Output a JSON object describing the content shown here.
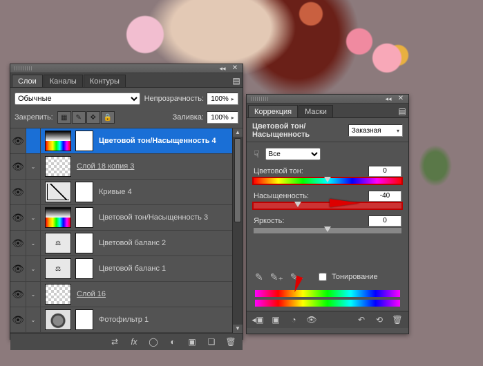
{
  "layers_panel": {
    "tabs": [
      "Слои",
      "Каналы",
      "Контуры"
    ],
    "active_tab": 0,
    "blend_mode": "Обычные",
    "opacity_label": "Непрозрачность:",
    "opacity_value": "100%",
    "lock_label": "Закрепить:",
    "fill_label": "Заливка:",
    "fill_value": "100%",
    "layers": [
      {
        "name": "Цветовой тон/Насыщенность 4",
        "selected": true,
        "kind": "adj-hue",
        "mask": true,
        "sub": false,
        "underline": false
      },
      {
        "name": "Слой 18 копия 3",
        "selected": false,
        "kind": "transparent",
        "mask": false,
        "sub": true,
        "underline": true
      },
      {
        "name": "Кривые 4",
        "selected": false,
        "kind": "adj-curves",
        "mask": true,
        "sub": false,
        "underline": false
      },
      {
        "name": "Цветовой тон/Насыщенность 3",
        "selected": false,
        "kind": "adj-hue",
        "mask": true,
        "sub": true,
        "underline": false
      },
      {
        "name": "Цветовой баланс 2",
        "selected": false,
        "kind": "adj-balance",
        "mask": true,
        "sub": true,
        "underline": false
      },
      {
        "name": "Цветовой баланс 1",
        "selected": false,
        "kind": "adj-balance",
        "mask": true,
        "sub": true,
        "underline": false
      },
      {
        "name": "Слой 16",
        "selected": false,
        "kind": "transparent",
        "mask": false,
        "sub": true,
        "underline": true
      },
      {
        "name": "Фотофильтр 1",
        "selected": false,
        "kind": "adj-photofilter",
        "mask": true,
        "sub": true,
        "underline": false
      }
    ],
    "footer_icons": [
      "link",
      "fx",
      "mask",
      "adj",
      "group",
      "new",
      "trash"
    ]
  },
  "adjust_panel": {
    "tabs": [
      "Коррекция",
      "Маски"
    ],
    "active_tab": 0,
    "title": "Цветовой тон/Насыщенность",
    "preset": "Заказная",
    "edit_label": "Все",
    "sliders": {
      "hue": {
        "label": "Цветовой тон:",
        "value": "0",
        "knob_pct": 50
      },
      "saturation": {
        "label": "Насыщенность:",
        "value": "-40",
        "knob_pct": 30
      },
      "lightness": {
        "label": "Яркость:",
        "value": "0",
        "knob_pct": 50
      }
    },
    "colorize_label": "Тонирование"
  }
}
